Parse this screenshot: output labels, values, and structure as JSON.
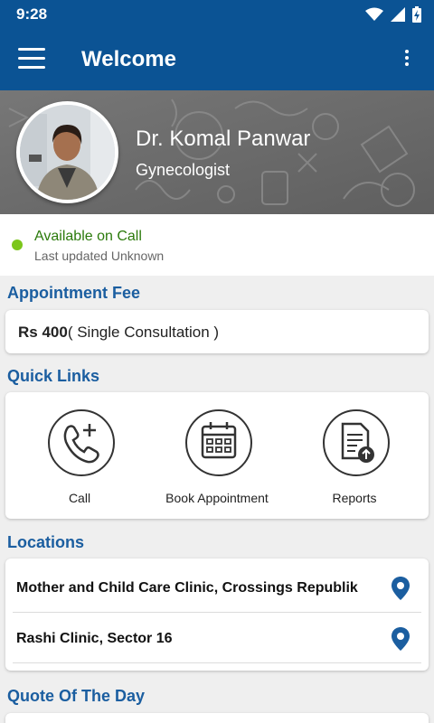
{
  "status_bar": {
    "time": "9:28"
  },
  "app_bar": {
    "title": "Welcome"
  },
  "doctor": {
    "name": "Dr. Komal Panwar",
    "specialty": "Gynecologist"
  },
  "availability": {
    "status": "Available on Call",
    "updated": "Last updated Unknown"
  },
  "appointment_fee": {
    "section_title": "Appointment Fee",
    "amount": "Rs 400",
    "description": "( Single Consultation )"
  },
  "quick_links": {
    "section_title": "Quick Links",
    "items": [
      {
        "label": "Call",
        "icon": "phone-plus-icon"
      },
      {
        "label": "Book Appointment",
        "icon": "calendar-icon"
      },
      {
        "label": "Reports",
        "icon": "report-upload-icon"
      }
    ]
  },
  "locations": {
    "section_title": "Locations",
    "items": [
      {
        "name": "Mother and Child Care Clinic, Crossings Republik",
        "icon": "location-pin-icon"
      },
      {
        "name": "Rashi Clinic, Sector 16",
        "icon": "location-pin-icon"
      }
    ]
  },
  "quote": {
    "section_title": "Quote Of The Day"
  },
  "colors": {
    "primary": "#0b5394",
    "accent_text": "#1b5ea0",
    "available_dot": "#7cc61c",
    "available_text": "#2b7a0b"
  }
}
